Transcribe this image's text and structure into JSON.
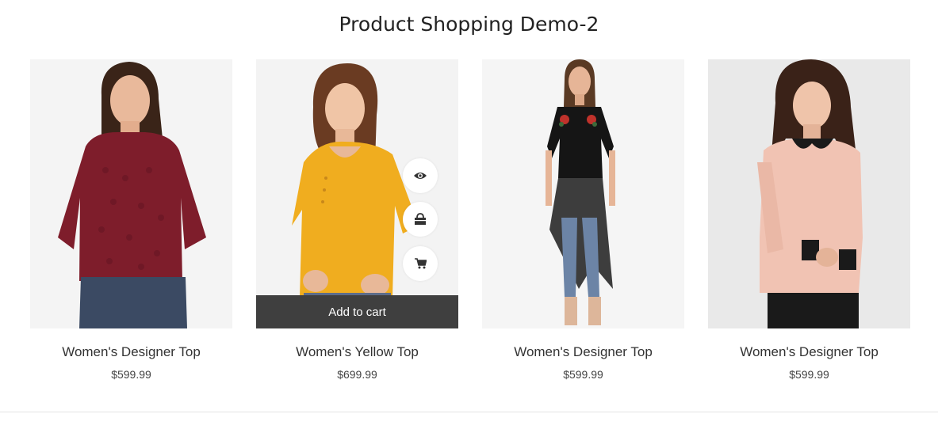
{
  "page": {
    "title": "Product Shopping Demo-2"
  },
  "products": [
    {
      "name": "Women's Designer Top",
      "price": "$599.99",
      "image": "woman-in-maroon-lace-top",
      "garment_color": "#7e1d2b"
    },
    {
      "name": "Women's Yellow Top",
      "price": "$699.99",
      "image": "woman-in-yellow-top",
      "garment_color": "#f0ad1f",
      "hovered": true,
      "actions": {
        "quick_view_icon": "eye-icon",
        "wishlist_icon": "shopping-bag-icon",
        "cart_icon": "shopping-cart-icon",
        "add_to_cart_label": "Add to cart"
      }
    },
    {
      "name": "Women's Designer Top",
      "price": "$599.99",
      "image": "woman-in-black-long-top",
      "garment_color": "#151515"
    },
    {
      "name": "Women's Designer Top",
      "price": "$599.99",
      "image": "woman-in-pink-collared-top",
      "garment_color": "#f1c3b3"
    }
  ],
  "colors": {
    "overlay_bar": "#3f3f3f",
    "title_text": "#222222",
    "image_background": "#f4f4f4"
  }
}
